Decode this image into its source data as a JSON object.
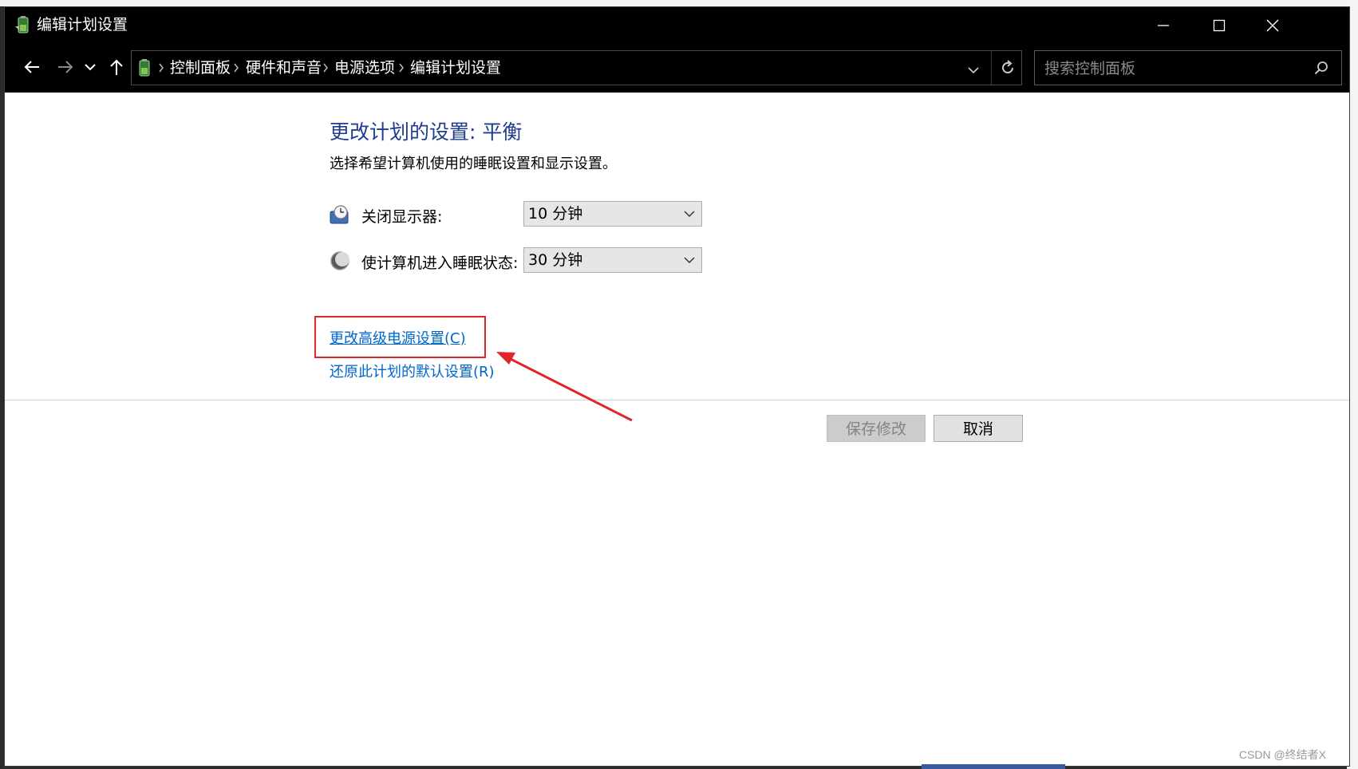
{
  "window": {
    "title": "编辑计划设置"
  },
  "nav": {
    "breadcrumb": [
      "控制面板",
      "硬件和声音",
      "电源选项",
      "编辑计划设置"
    ],
    "search_placeholder": "搜索控制面板"
  },
  "main": {
    "heading": "更改计划的设置: 平衡",
    "subtitle": "选择希望计算机使用的睡眠设置和显示设置。",
    "display": {
      "label": "关闭显示器:",
      "value": "10 分钟"
    },
    "sleep": {
      "label": "使计算机进入睡眠状态:",
      "value": "30 分钟"
    },
    "links": {
      "advanced": "更改高级电源设置(C)",
      "restore": "还原此计划的默认设置(R)"
    },
    "buttons": {
      "save": "保存修改",
      "cancel": "取消"
    }
  },
  "annotation": {
    "color": "#e0262b"
  },
  "watermark": "CSDN @终结者X"
}
